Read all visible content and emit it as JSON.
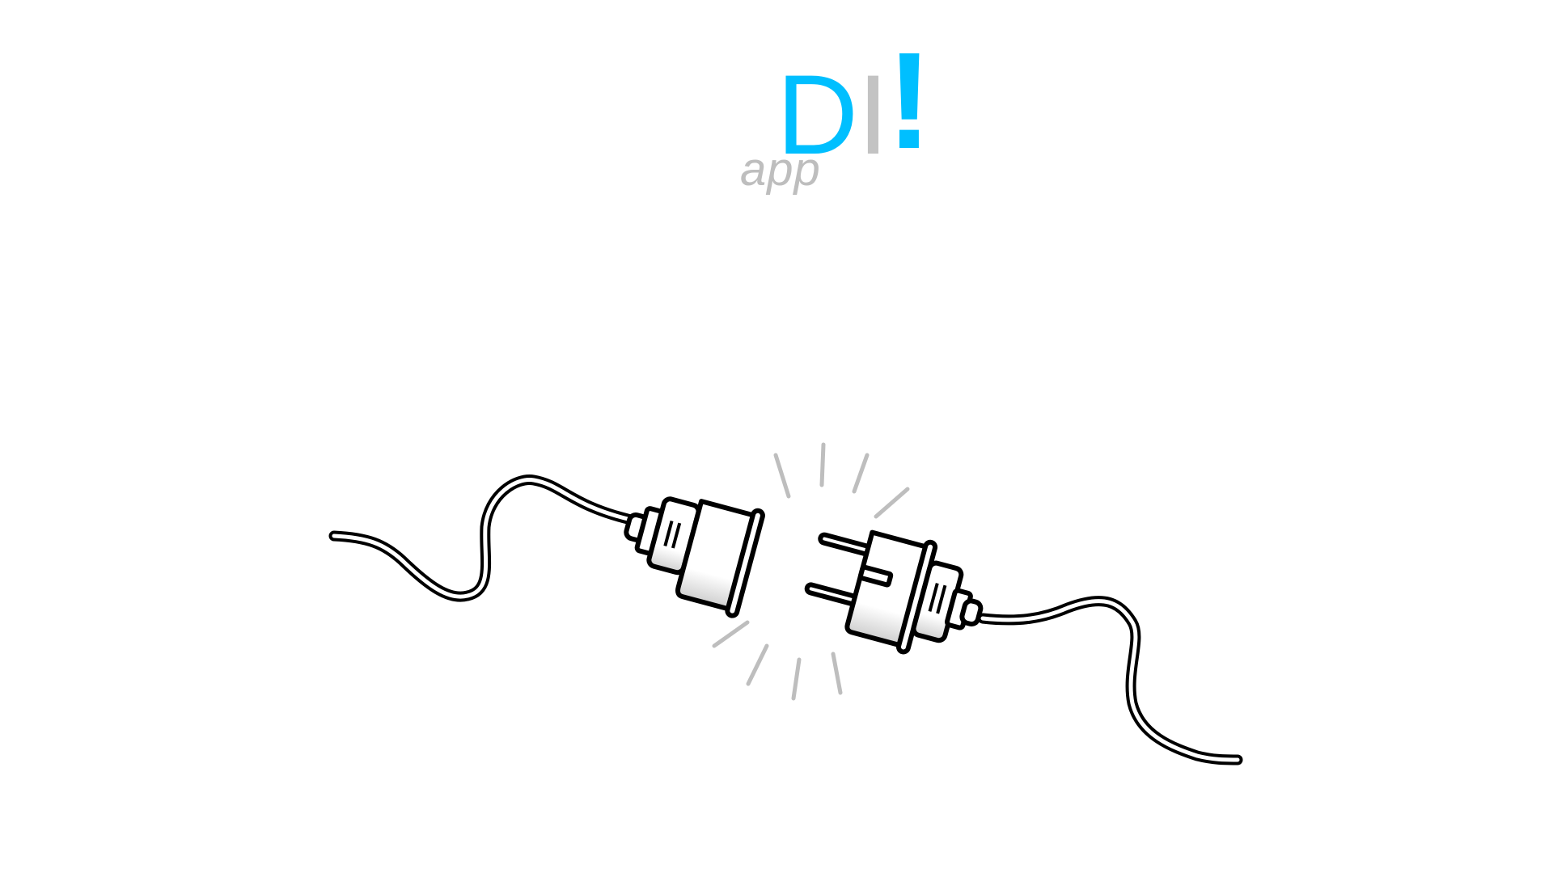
{
  "logo": {
    "letter_d": "D",
    "letter_i": "I",
    "exclamation": "!",
    "tagline": "app",
    "colors": {
      "accent": "#00BFFF",
      "secondary": "#C3C3C3"
    }
  },
  "illustration": {
    "name": "unplugged-power-cord",
    "colors": {
      "stroke": "#000000",
      "spark": "#BEBEBE",
      "fill": "#FFFFFF"
    }
  }
}
